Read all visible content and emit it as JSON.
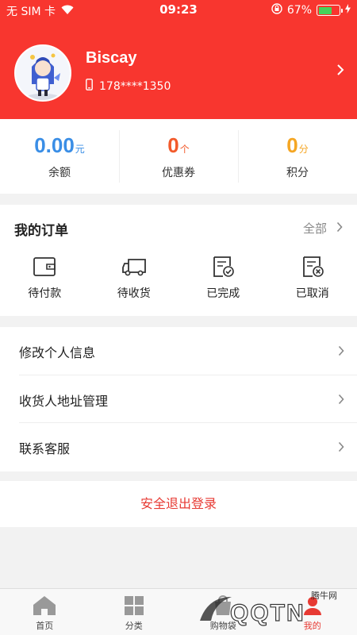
{
  "status_bar": {
    "carrier": "无 SIM 卡",
    "time": "09:23",
    "battery_percent": "67%",
    "battery_level": 0.67
  },
  "profile": {
    "name": "Biscay",
    "phone": "178****1350"
  },
  "stats": [
    {
      "value": "0.00",
      "unit": "元",
      "label": "余额",
      "color": "#3a8ee6"
    },
    {
      "value": "0",
      "unit": "个",
      "label": "优惠券",
      "color": "#f25a2b"
    },
    {
      "value": "0",
      "unit": "分",
      "label": "积分",
      "color": "#f5a623"
    }
  ],
  "orders": {
    "title": "我的订单",
    "all_label": "全部",
    "items": [
      {
        "label": "待付款",
        "icon": "wallet-icon"
      },
      {
        "label": "待收货",
        "icon": "truck-icon"
      },
      {
        "label": "已完成",
        "icon": "check-doc-icon"
      },
      {
        "label": "已取消",
        "icon": "cancel-doc-icon"
      }
    ]
  },
  "menu": [
    {
      "label": "修改个人信息"
    },
    {
      "label": "收货人地址管理"
    },
    {
      "label": "联系客服"
    }
  ],
  "logout_label": "安全退出登录",
  "tabs": [
    {
      "label": "首页",
      "icon": "home-icon"
    },
    {
      "label": "分类",
      "icon": "grid-icon"
    },
    {
      "label": "购物袋",
      "icon": "bag-icon"
    },
    {
      "label": "我的",
      "icon": "user-icon"
    }
  ],
  "watermark": {
    "text": "QQTN",
    "sub": "腾牛网"
  },
  "colors": {
    "header_red": "#f8362f",
    "accent_red": "#e73a33"
  }
}
